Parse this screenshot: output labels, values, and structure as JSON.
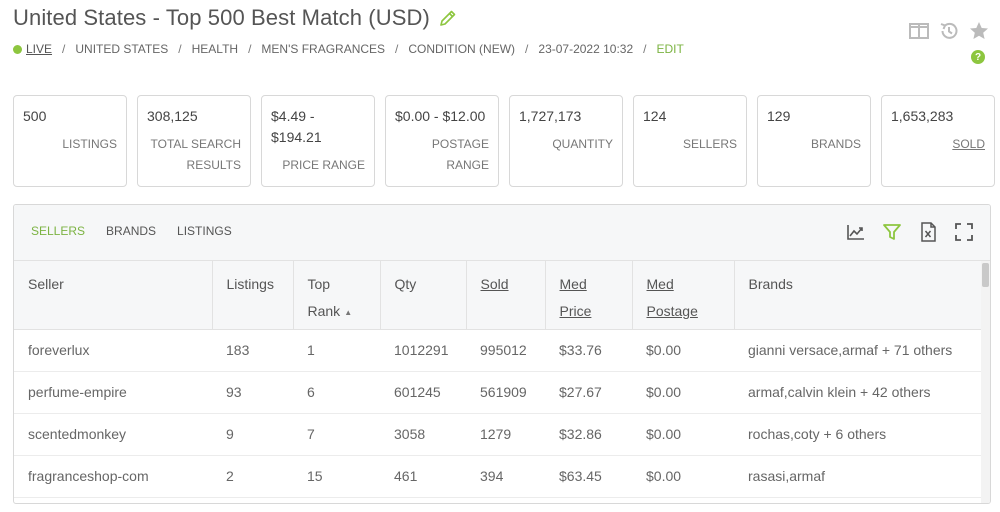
{
  "header": {
    "title": "United States - Top 500 Best Match (USD)",
    "status": "LIVE",
    "breadcrumbs": [
      "UNITED STATES",
      "HEALTH",
      "MEN'S FRAGRANCES",
      "CONDITION (NEW)",
      "23-07-2022 10:32"
    ],
    "edit_label": "EDIT",
    "help_label": "?"
  },
  "stats": [
    {
      "value": "500",
      "label": "LISTINGS"
    },
    {
      "value": "308,125",
      "label": "TOTAL SEARCH RESULTS"
    },
    {
      "value": "$4.49 - $194.21",
      "label": "PRICE RANGE"
    },
    {
      "value": "$0.00 - $12.00",
      "label": "POSTAGE RANGE"
    },
    {
      "value": "1,727,173",
      "label": "QUANTITY"
    },
    {
      "value": "124",
      "label": "SELLERS"
    },
    {
      "value": "129",
      "label": "BRANDS"
    },
    {
      "value": "1,653,283",
      "label": "SOLD"
    }
  ],
  "tabs": [
    "SELLERS",
    "BRANDS",
    "LISTINGS"
  ],
  "table": {
    "columns": {
      "seller": "Seller",
      "listings": "Listings",
      "top": "Top",
      "rank": "Rank",
      "qty": "Qty",
      "sold": "Sold",
      "med1": "Med",
      "price": "Price",
      "med2": "Med",
      "postage": "Postage",
      "brands": "Brands"
    },
    "rows": [
      {
        "seller": "foreverlux",
        "listings": "183",
        "rank": "1",
        "qty": "1012291",
        "sold": "995012",
        "price": "$33.76",
        "postage": "$0.00",
        "brands": "gianni versace,armaf + 71 others"
      },
      {
        "seller": "perfume-empire",
        "listings": "93",
        "rank": "6",
        "qty": "601245",
        "sold": "561909",
        "price": "$27.67",
        "postage": "$0.00",
        "brands": "armaf,calvin klein + 42 others"
      },
      {
        "seller": "scentedmonkey",
        "listings": "9",
        "rank": "7",
        "qty": "3058",
        "sold": "1279",
        "price": "$32.86",
        "postage": "$0.00",
        "brands": "rochas,coty + 6 others"
      },
      {
        "seller": "fragranceshop-com",
        "listings": "2",
        "rank": "15",
        "qty": "461",
        "sold": "394",
        "price": "$63.45",
        "postage": "$0.00",
        "brands": "rasasi,armaf"
      }
    ]
  },
  "icons": {
    "edit": "pencil-icon",
    "layout": "columns-icon",
    "history": "history-icon",
    "favorite": "star-icon",
    "chart": "line-chart-icon",
    "filter": "filter-icon",
    "export": "excel-export-icon",
    "fullscreen": "fullscreen-icon"
  },
  "colors": {
    "accent": "#8dc63f",
    "text": "#555555",
    "border": "#d8d8d8"
  }
}
